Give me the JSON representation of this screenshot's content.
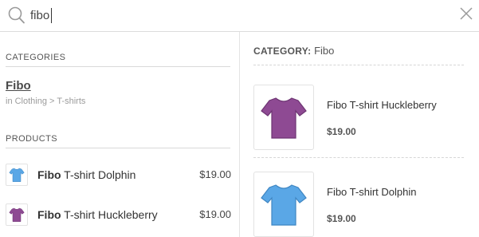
{
  "search": {
    "query": "fibo",
    "icon": "search-icon",
    "clear_icon": "close-icon"
  },
  "left": {
    "categories_heading": "CATEGORIES",
    "category": {
      "title": "Fibo",
      "path": "in Clothing > T-shirts"
    },
    "products_heading": "PRODUCTS",
    "products": [
      {
        "highlight": "Fibo",
        "name": " T-shirt Dolphin",
        "price": "$19.00",
        "color": "#5aa7e6"
      },
      {
        "highlight": "Fibo",
        "name": " T-shirt Huckleberry",
        "price": "$19.00",
        "color": "#8e4a93"
      }
    ]
  },
  "right": {
    "heading_label": "CATEGORY:",
    "heading_value": " Fibo",
    "items": [
      {
        "name": "Fibo T-shirt Huckleberry",
        "price": "$19.00",
        "color": "#8e4a93"
      },
      {
        "name": "Fibo T-shirt Dolphin",
        "price": "$19.00",
        "color": "#5aa7e6"
      }
    ]
  }
}
